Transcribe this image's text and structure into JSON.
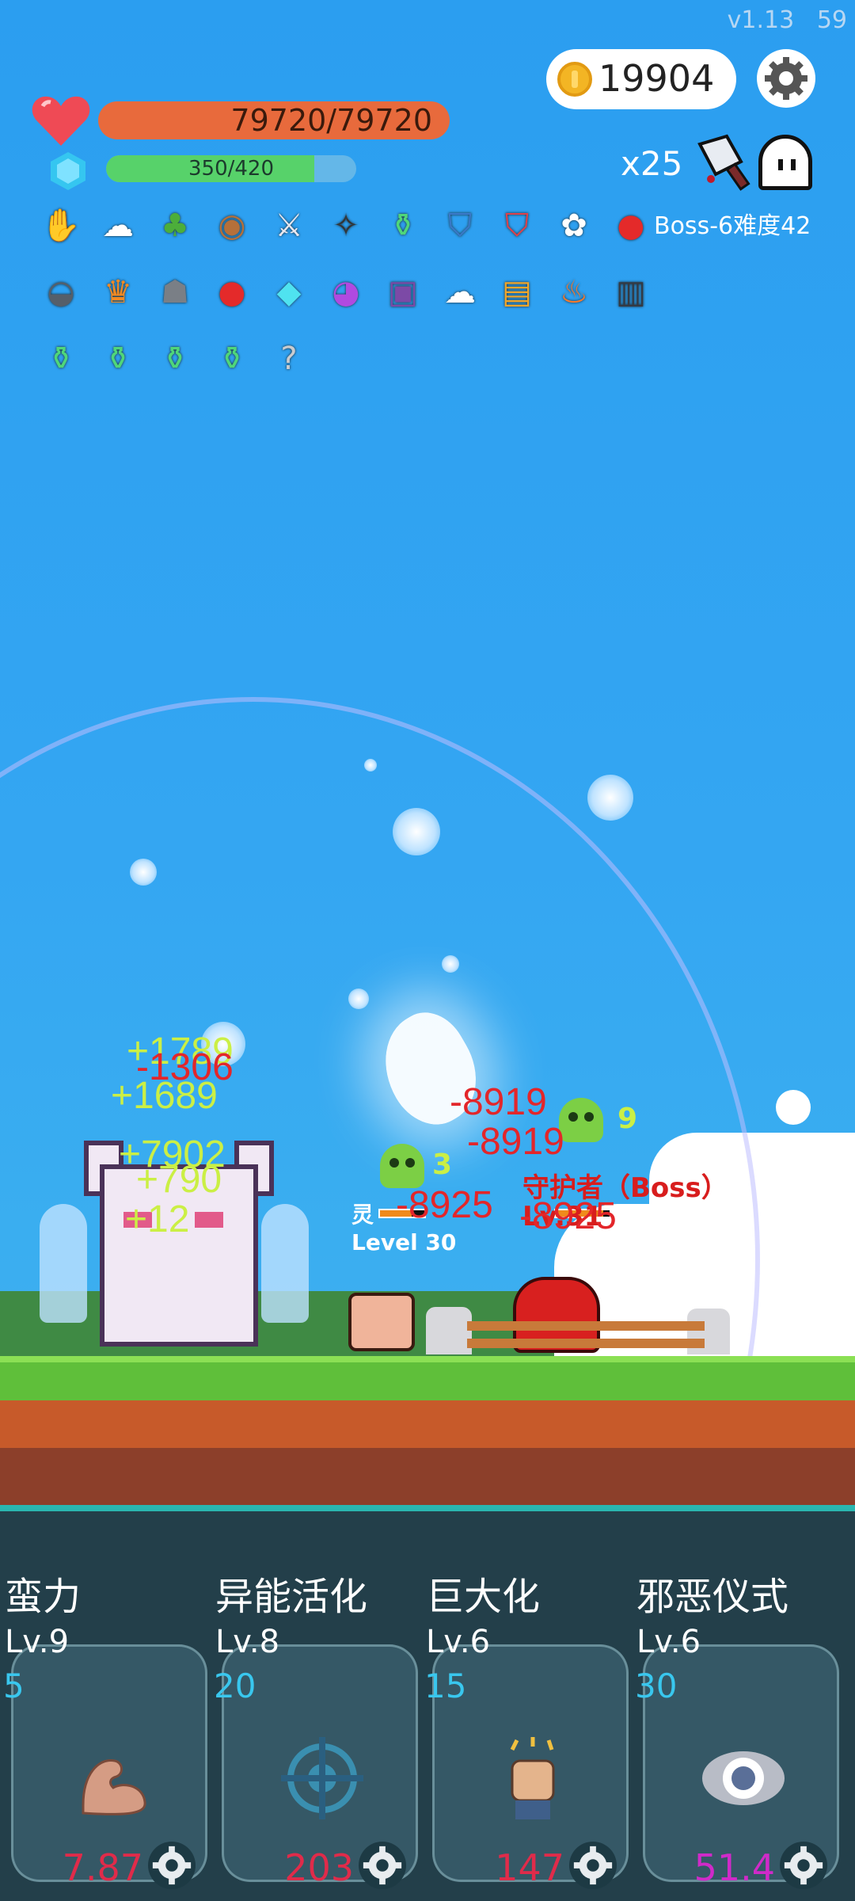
{
  "version": "v1.13",
  "fps": "59",
  "coins": "19904",
  "player": {
    "hp_text": "79720/79720",
    "hp_fraction": 1.0,
    "mp_text": "350/420",
    "mp_fraction": 0.833
  },
  "combo": "x25",
  "boss_info": "Boss-6难度42",
  "items": [
    {
      "name": "hand-item-icon",
      "glyph": "✋",
      "color": "#f0c070"
    },
    {
      "name": "wing-item-icon",
      "glyph": "☁",
      "color": "#ffffff"
    },
    {
      "name": "tree-item-icon",
      "glyph": "♣",
      "color": "#4cae3a"
    },
    {
      "name": "round-shield-item-icon",
      "glyph": "◉",
      "color": "#b5703a"
    },
    {
      "name": "sword-item-icon",
      "glyph": "⚔",
      "color": "#e8e8f0"
    },
    {
      "name": "bat-item-icon",
      "glyph": "✧",
      "color": "#333333"
    },
    {
      "name": "potion-item-icon",
      "glyph": "⚱",
      "color": "#4fd67a"
    },
    {
      "name": "blue-shield-item-icon",
      "glyph": "⛉",
      "color": "#3a79c9"
    },
    {
      "name": "red-shield-item-icon",
      "glyph": "⛉",
      "color": "#e0414a"
    },
    {
      "name": "flower-item-icon",
      "glyph": "✿",
      "color": "#ffffff"
    },
    {
      "name": "apple-item-icon",
      "glyph": "●",
      "color": "#e42a2a"
    },
    {
      "name": "mortar-item-icon",
      "glyph": "◒",
      "color": "#555f6a"
    },
    {
      "name": "crown-item-icon",
      "glyph": "♛",
      "color": "#f08a24"
    },
    {
      "name": "helmet-item-icon",
      "glyph": "☗",
      "color": "#7a7f86"
    },
    {
      "name": "apple2-item-icon",
      "glyph": "●",
      "color": "#e42a2a"
    },
    {
      "name": "diamond-item-icon",
      "glyph": "◆",
      "color": "#4fe3f0"
    },
    {
      "name": "crystal-ball-item-icon",
      "glyph": "◕",
      "color": "#b04ae0"
    },
    {
      "name": "spell-book-item-icon",
      "glyph": "▣",
      "color": "#7c4aa6"
    },
    {
      "name": "wing2-item-icon",
      "glyph": "☁",
      "color": "#ffffff"
    },
    {
      "name": "gold-book-item-icon",
      "glyph": "▤",
      "color": "#f0a62a"
    },
    {
      "name": "torch-item-icon",
      "glyph": "♨",
      "color": "#ff7a2a"
    },
    {
      "name": "skull-book-item-icon",
      "glyph": "▥",
      "color": "#333a44"
    },
    {
      "name": "green-potion1-icon",
      "glyph": "⚱",
      "color": "#4fd67a"
    },
    {
      "name": "green-potion2-icon",
      "glyph": "⚱",
      "color": "#4fd67a"
    },
    {
      "name": "green-potion3-icon",
      "glyph": "⚱",
      "color": "#4fd67a"
    },
    {
      "name": "green-potion4-icon",
      "glyph": "⚱",
      "color": "#4fd67a"
    },
    {
      "name": "hook-item-icon",
      "glyph": "?",
      "color": "#c9ccd0"
    }
  ],
  "damage_numbers": [
    {
      "text": "+1789",
      "color": "green"
    },
    {
      "text": "-1306",
      "color": "red"
    },
    {
      "text": "+1689",
      "color": "green"
    },
    {
      "text": "+7902",
      "color": "green"
    },
    {
      "text": "+790",
      "color": "green"
    },
    {
      "text": "+12",
      "color": "green"
    },
    {
      "text": "-8919",
      "color": "red"
    },
    {
      "text": "-8919",
      "color": "red"
    },
    {
      "text": "-8925",
      "color": "red"
    },
    {
      "text": "-8925",
      "color": "red"
    }
  ],
  "enemies": {
    "small_name": "灵",
    "small_level": "Level 30",
    "boss_name": "守护者（Boss）",
    "boss_level": "Lv.31",
    "skull_small_num": "3",
    "skull_boss_num": "9"
  },
  "skills": [
    {
      "name": "蛮力",
      "level": "Lv.9",
      "cost": "5",
      "value": "7.87",
      "icon": "muscle-icon",
      "value_color": "#e02b4a"
    },
    {
      "name": "异能活化",
      "level": "Lv.8",
      "cost": "20",
      "value": "203",
      "icon": "crosshair-icon",
      "value_color": "#e02b4a"
    },
    {
      "name": "巨大化",
      "level": "Lv.6",
      "cost": "15",
      "value": "147",
      "icon": "fist-icon",
      "value_color": "#e02b4a"
    },
    {
      "name": "邪恶仪式",
      "level": "Lv.6",
      "cost": "30",
      "value": "51.4",
      "icon": "eye-icon",
      "value_color": "#d02ac9"
    }
  ]
}
